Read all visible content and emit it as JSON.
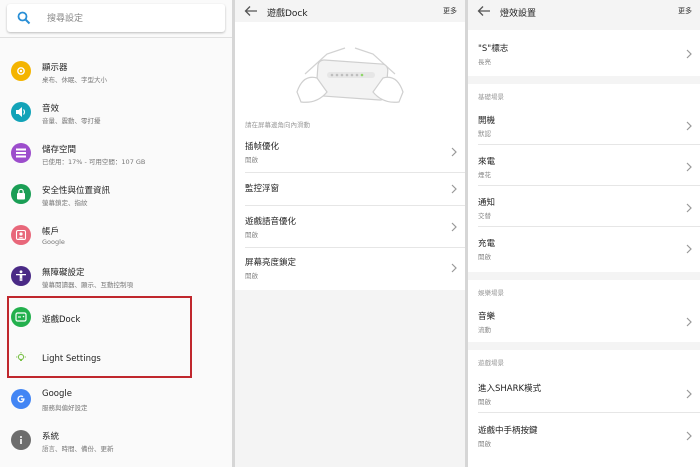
{
  "settings": {
    "search_placeholder": "搜尋設定",
    "items": [
      {
        "label": "顯示器",
        "sub": "桌布、休眠、字型大小",
        "icon": "brightness-icon",
        "color": "#f4b400"
      },
      {
        "label": "音效",
        "sub": "音量、震動、零打擾",
        "icon": "volume-icon",
        "color": "#12a3b8"
      },
      {
        "label": "儲存空間",
        "sub": "已使用：17% - 可用空間：107 GB",
        "icon": "storage-icon",
        "color": "#9c4dcc"
      },
      {
        "label": "安全性與位置資訊",
        "sub": "螢幕鎖定、指紋",
        "icon": "lock-icon",
        "color": "#1a9e55"
      },
      {
        "label": "帳戶",
        "sub": "Google",
        "icon": "account-icon",
        "color": "#e8677a"
      },
      {
        "label": "無障礙設定",
        "sub": "螢幕閱讀器、顯示、互動控制項",
        "icon": "accessibility-icon",
        "color": "#4a2a86"
      },
      {
        "label": "遊戲Dock",
        "sub": "",
        "icon": "game-dock-icon",
        "color": "#23b04d"
      },
      {
        "label": "Light Settings",
        "sub": "",
        "icon": "lightbulb-icon",
        "color": "#7cc24a"
      },
      {
        "label": "Google",
        "sub": "服務與偏好設定",
        "icon": "google-icon",
        "color": "#4285f4"
      },
      {
        "label": "系統",
        "sub": "語言、時間、備份、更新",
        "icon": "info-icon",
        "color": "#6d6d6d"
      }
    ]
  },
  "dock": {
    "title": "遊戲Dock",
    "more": "更多",
    "section": "請在屏幕邊角向內滑動",
    "items": [
      {
        "label": "插帧優化",
        "sub": "開啟"
      },
      {
        "label": "監控浮窗",
        "sub": ""
      },
      {
        "label": "遊戲語音優化",
        "sub": "開啟"
      },
      {
        "label": "屏幕亮度鎖定",
        "sub": "開啟"
      }
    ]
  },
  "light": {
    "title": "燈效設置",
    "more": "更多",
    "logo": {
      "label": "\"S\"標志",
      "sub": "長亮"
    },
    "section_basic": "基礎場景",
    "basic": [
      {
        "label": "開機",
        "sub": "默認"
      },
      {
        "label": "來電",
        "sub": "煙花"
      },
      {
        "label": "通知",
        "sub": "交替"
      },
      {
        "label": "充電",
        "sub": "開啟"
      }
    ],
    "section_media": "娛樂場景",
    "media": [
      {
        "label": "音樂",
        "sub": "流動"
      }
    ],
    "section_game": "遊戲場景",
    "game": [
      {
        "label": "進入SHARK模式",
        "sub": "開啟"
      },
      {
        "label": "遊戲中手柄按鍵",
        "sub": "開啟"
      }
    ]
  }
}
